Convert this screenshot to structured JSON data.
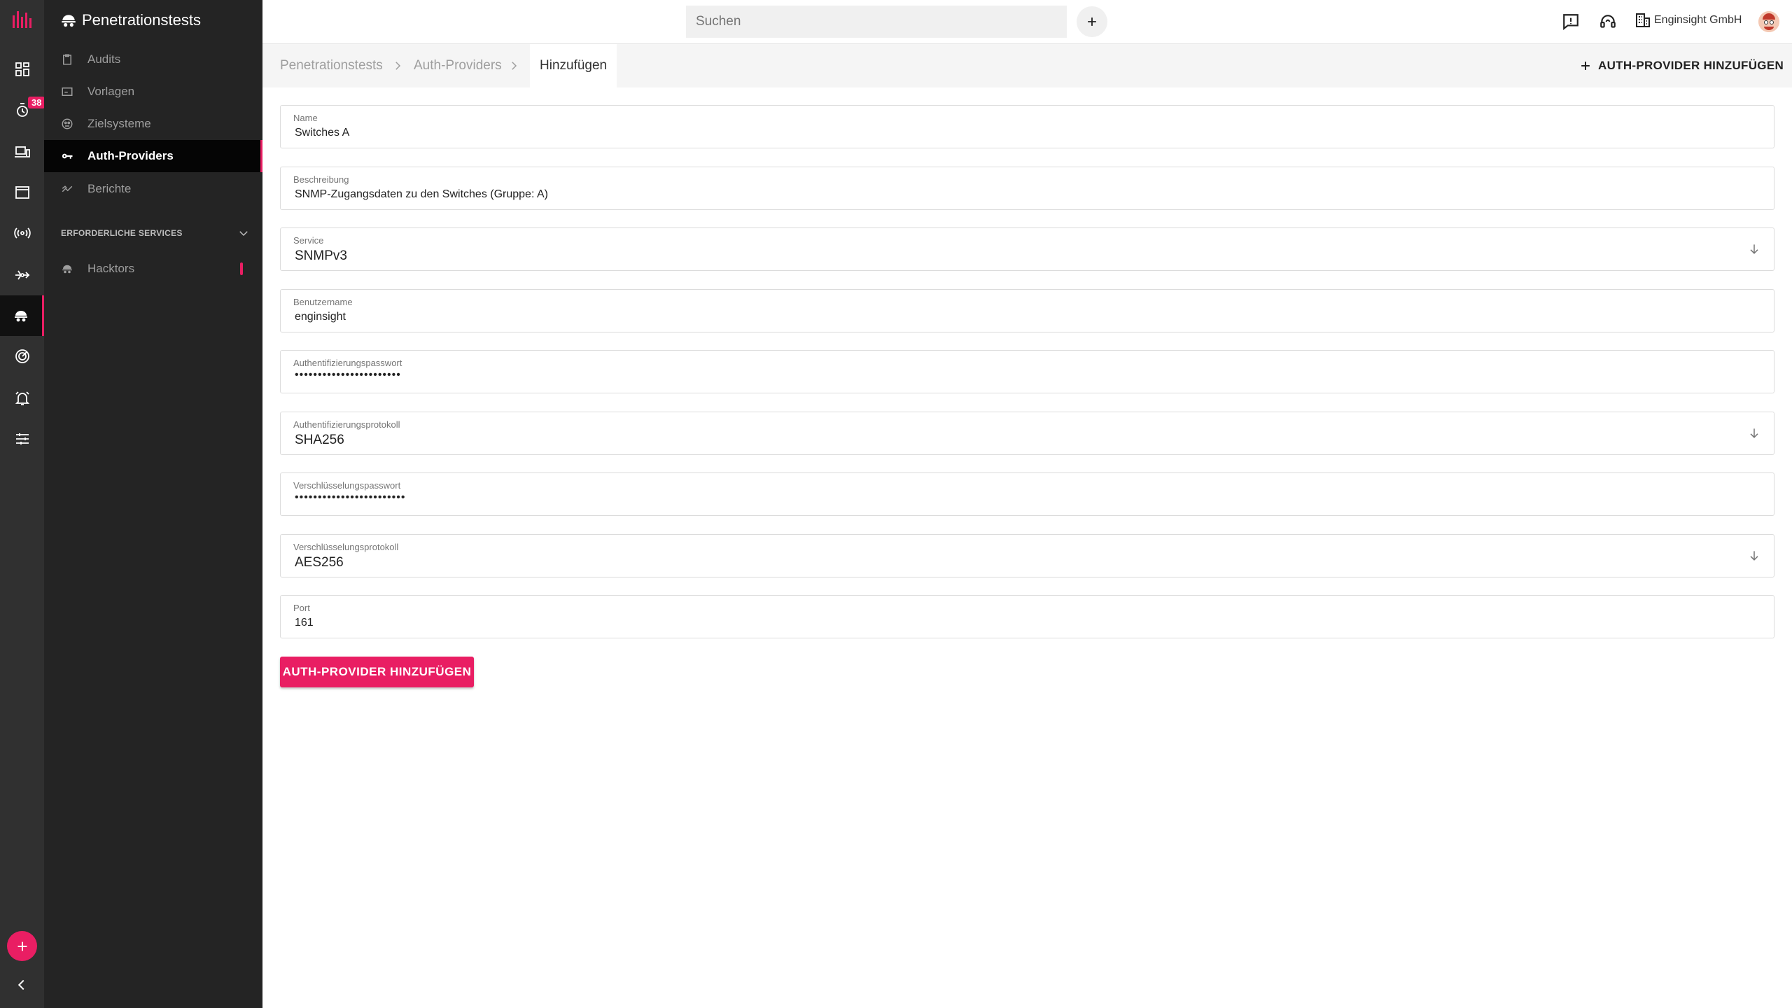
{
  "rail": {
    "badge_count": "38",
    "accent": "#e91e63"
  },
  "sidebar": {
    "title": "Penetrationstests",
    "items": [
      {
        "label": "Audits",
        "icon": "clipboard-icon"
      },
      {
        "label": "Vorlagen",
        "icon": "template-icon"
      },
      {
        "label": "Zielsysteme",
        "icon": "target-systems-icon"
      },
      {
        "label": "Auth-Providers",
        "icon": "key-icon"
      },
      {
        "label": "Berichte",
        "icon": "report-icon"
      }
    ],
    "section_title": "ERFORDERLICHE SERVICES",
    "services": [
      {
        "label": "Hacktors",
        "icon": "hacktor-icon"
      }
    ]
  },
  "topbar": {
    "search_placeholder": "Suchen",
    "organization": "Enginsight GmbH"
  },
  "breadcrumb": {
    "items": [
      "Penetrationstests",
      "Auth-Providers",
      "Hinzufügen"
    ],
    "action_label": "AUTH-PROVIDER HINZUFÜGEN"
  },
  "form": {
    "fields": [
      {
        "label": "Name",
        "value": "Switches A"
      },
      {
        "label": "Beschreibung",
        "value": "SNMP-Zugangsdaten zu den Switches (Gruppe: A)"
      },
      {
        "label": "Service",
        "value": "SNMPv3"
      },
      {
        "label": "Benutzername",
        "value": "enginsight"
      },
      {
        "label": "Authentifizierungspasswort",
        "value": "•••••••••••••••••••••••"
      },
      {
        "label": "Authentifizierungsprotokoll",
        "value": "SHA256"
      },
      {
        "label": "Verschlüsselungspasswort",
        "value": "••••••••••••••••••••••••"
      },
      {
        "label": "Verschlüsselungsprotokoll",
        "value": "AES256"
      },
      {
        "label": "Port",
        "value": "161"
      }
    ],
    "submit_label": "AUTH-PROVIDER HINZUFÜGEN"
  }
}
